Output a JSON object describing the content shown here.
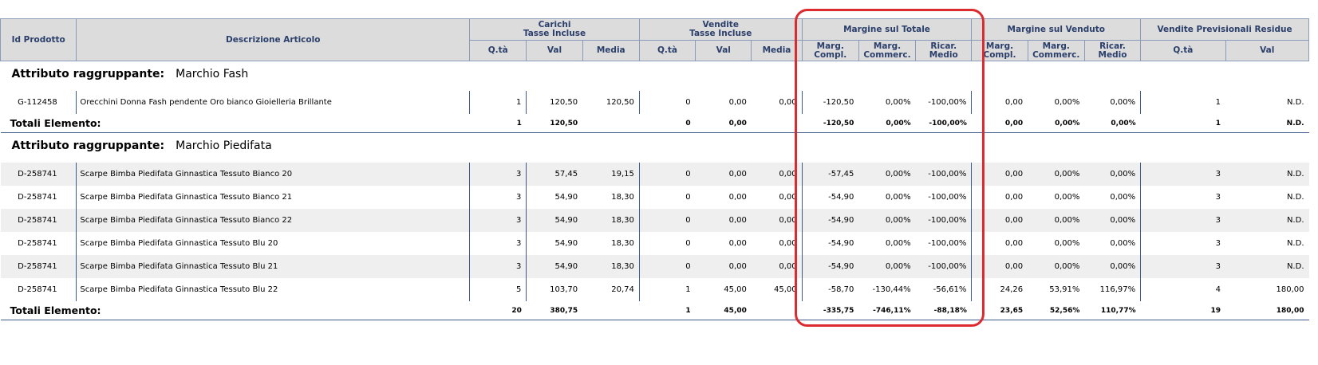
{
  "headers": {
    "id": "Id Prodotto",
    "desc": "Descrizione Articolo",
    "carichi_l1": "Carichi",
    "carichi_l2": "Tasse Incluse",
    "vendite_l1": "Vendite",
    "vendite_l2": "Tasse Incluse",
    "margine_totale": "Margine sul Totale",
    "margine_venduto": "Margine sul Venduto",
    "vendite_prev": "Vendite Previsionali Residue",
    "qta": "Q.tà",
    "val": "Val",
    "media": "Media",
    "marg_compl_l1": "Marg.",
    "marg_compl_l2": "Compl.",
    "marg_comm_l1": "Marg.",
    "marg_comm_l2": "Commerc.",
    "ricar": "Ricar. Medio"
  },
  "groups": [
    {
      "attr_label": "Attributo raggruppante:",
      "attr_value": "Marchio Fash",
      "rows": [
        [
          "G-112458",
          "Orecchini Donna Fash pendente Oro bianco Gioielleria Brillante",
          "1",
          "120,50",
          "120,50",
          "0",
          "0,00",
          "0,00",
          "-120,50",
          "0,00%",
          "-100,00%",
          "0,00",
          "0,00%",
          "0,00%",
          "1",
          "N.D."
        ]
      ],
      "totals": {
        "label": "Totali Elemento:",
        "values": [
          "1",
          "120,50",
          "",
          "0",
          "0,00",
          "",
          "-120,50",
          "0,00%",
          "-100,00%",
          "0,00",
          "0,00%",
          "0,00%",
          "1",
          "N.D."
        ]
      }
    },
    {
      "attr_label": "Attributo raggruppante:",
      "attr_value": "Marchio Piedifata",
      "rows": [
        [
          "D-258741",
          "Scarpe Bimba Piedifata Ginnastica Tessuto Bianco 20",
          "3",
          "57,45",
          "19,15",
          "0",
          "0,00",
          "0,00",
          "-57,45",
          "0,00%",
          "-100,00%",
          "0,00",
          "0,00%",
          "0,00%",
          "3",
          "N.D."
        ],
        [
          "D-258741",
          "Scarpe Bimba Piedifata Ginnastica Tessuto Bianco 21",
          "3",
          "54,90",
          "18,30",
          "0",
          "0,00",
          "0,00",
          "-54,90",
          "0,00%",
          "-100,00%",
          "0,00",
          "0,00%",
          "0,00%",
          "3",
          "N.D."
        ],
        [
          "D-258741",
          "Scarpe Bimba Piedifata Ginnastica Tessuto Bianco 22",
          "3",
          "54,90",
          "18,30",
          "0",
          "0,00",
          "0,00",
          "-54,90",
          "0,00%",
          "-100,00%",
          "0,00",
          "0,00%",
          "0,00%",
          "3",
          "N.D."
        ],
        [
          "D-258741",
          "Scarpe Bimba Piedifata Ginnastica Tessuto Blu 20",
          "3",
          "54,90",
          "18,30",
          "0",
          "0,00",
          "0,00",
          "-54,90",
          "0,00%",
          "-100,00%",
          "0,00",
          "0,00%",
          "0,00%",
          "3",
          "N.D."
        ],
        [
          "D-258741",
          "Scarpe Bimba Piedifata Ginnastica Tessuto Blu 21",
          "3",
          "54,90",
          "18,30",
          "0",
          "0,00",
          "0,00",
          "-54,90",
          "0,00%",
          "-100,00%",
          "0,00",
          "0,00%",
          "0,00%",
          "3",
          "N.D."
        ],
        [
          "D-258741",
          "Scarpe Bimba Piedifata Ginnastica Tessuto Blu 22",
          "5",
          "103,70",
          "20,74",
          "1",
          "45,00",
          "45,00",
          "-58,70",
          "-130,44%",
          "-56,61%",
          "24,26",
          "53,91%",
          "116,97%",
          "4",
          "180,00"
        ]
      ],
      "totals": {
        "label": "Totali Elemento:",
        "values": [
          "20",
          "380,75",
          "",
          "1",
          "45,00",
          "",
          "-335,75",
          "-746,11%",
          "-88,18%",
          "23,65",
          "52,56%",
          "110,77%",
          "19",
          "180,00"
        ]
      }
    }
  ],
  "colors": {
    "header_bg": "#dcdcdc",
    "header_text": "#2b3f6b",
    "row_alt": "#efefef",
    "rule": "#3e5a8a",
    "highlight": "#dd2a2f"
  }
}
